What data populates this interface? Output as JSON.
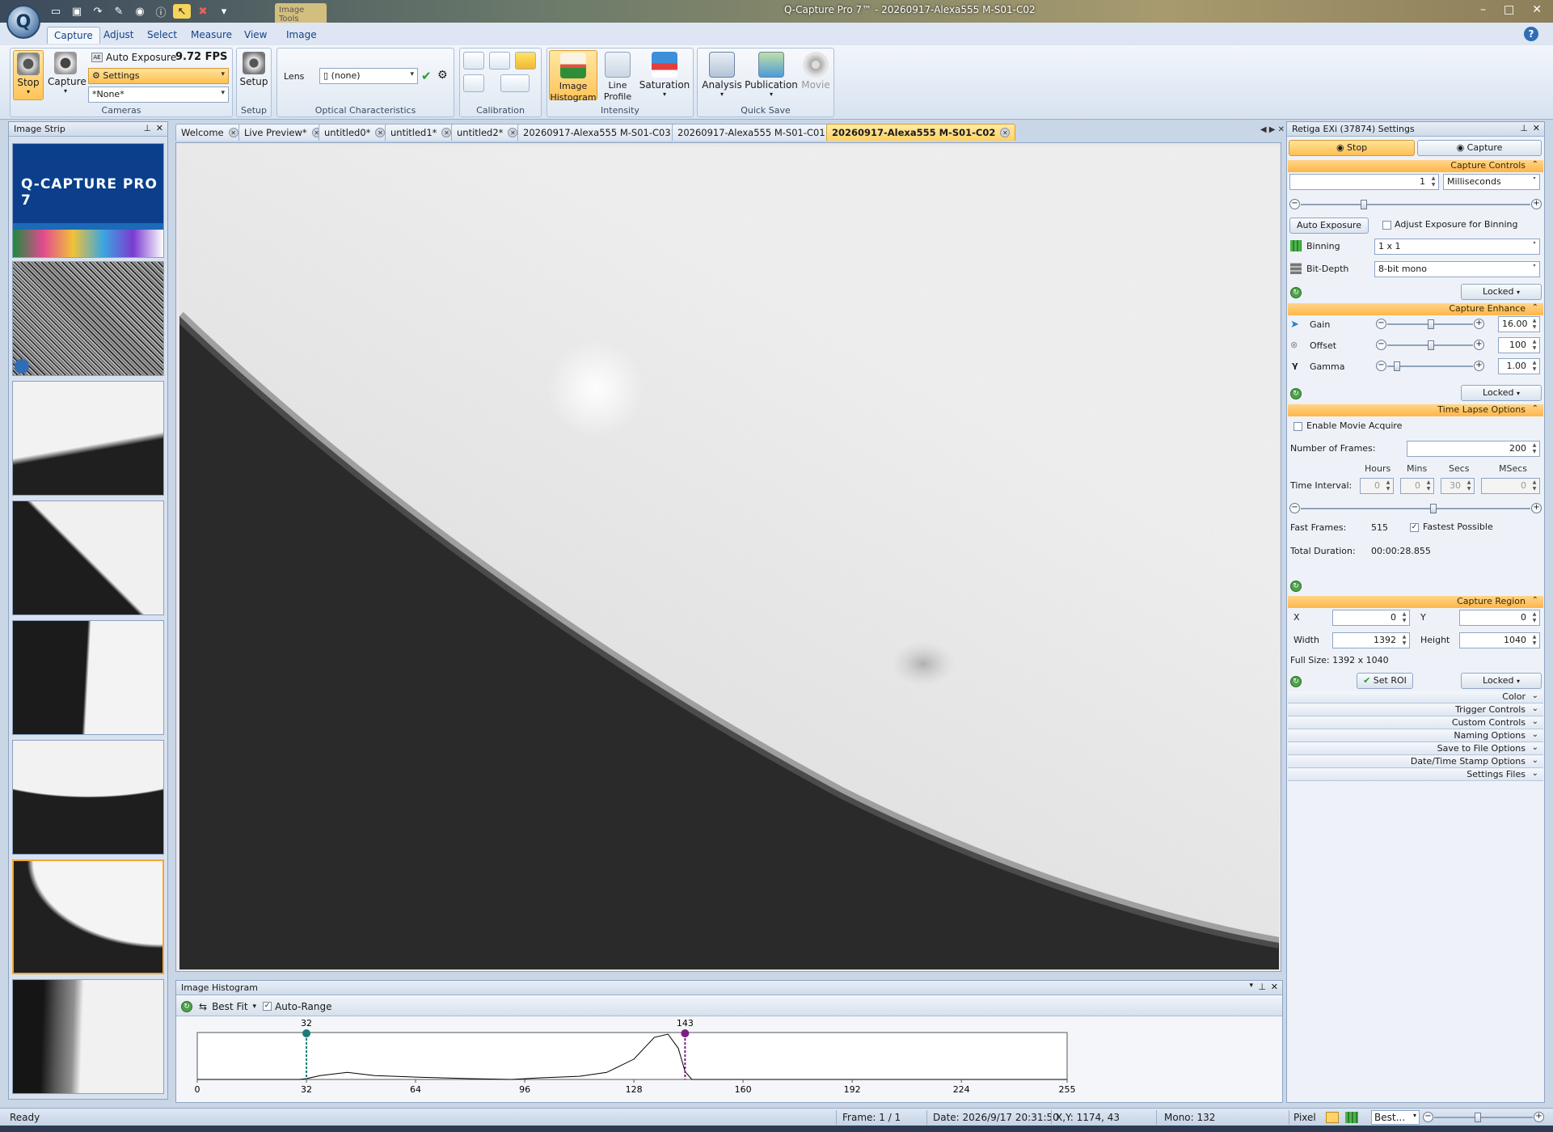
{
  "window": {
    "title": "Q-Capture Pro 7™ - 20260917-Alexa555 M-S01-C02",
    "context_tab": "Image Tools",
    "controls": [
      "–",
      "□",
      "✕"
    ]
  },
  "ribbon": {
    "tabs": [
      "Capture",
      "Adjust",
      "Select",
      "Measure",
      "View",
      "Image"
    ],
    "active_tab": "Capture",
    "cameras": {
      "stop_label": "Stop",
      "capture_label": "Capture",
      "auto_exposure_label": "Auto Exposure",
      "fps": "9.72 FPS",
      "settings_combo": "Settings",
      "preset_combo": "*None*",
      "group_label": "Cameras"
    },
    "setup": {
      "button_label": "Setup",
      "group_label": "Setup"
    },
    "optical": {
      "lens_label": "Lens",
      "lens_value": "(none)",
      "group_label": "Optical Characteristics"
    },
    "calibration": {
      "group_label": "Calibration"
    },
    "intensity": {
      "histogram_label": "Image Histogram",
      "line_profile_label": "Line Profile",
      "saturation_label": "Saturation",
      "group_label": "Intensity"
    },
    "quicksave": {
      "analysis_label": "Analysis",
      "publication_label": "Publication",
      "movie_label": "Movie",
      "group_label": "Quick Save"
    }
  },
  "image_strip": {
    "title": "Image Strip",
    "splash_logo": "Q-CAPTURE PRO 7"
  },
  "doc_tabs": [
    "Welcome",
    "Live Preview*",
    "untitled0*",
    "untitled1*",
    "untitled2*",
    "20260917-Alexa555 M-S01-C03",
    "20260917-Alexa555 M-S01-C01",
    "20260917-Alexa555 M-S01-C02"
  ],
  "active_doc_tab": "20260917-Alexa555 M-S01-C02",
  "histogram": {
    "title": "Image Histogram",
    "fit_label": "Best Fit",
    "auto_range_label": "Auto-Range",
    "auto_range_checked": true,
    "low_marker": "32",
    "high_marker": "143",
    "x_ticks": [
      "0",
      "32",
      "64",
      "96",
      "128",
      "160",
      "192",
      "224",
      "255"
    ],
    "colors": {
      "low": "#1e7b78",
      "high": "#7a1f82"
    }
  },
  "settings": {
    "title": "Retiga EXi (37874) Settings",
    "stop_tab": "Stop",
    "capture_tab": "Capture",
    "capture_controls": {
      "header": "Capture Controls",
      "exposure_value": "1",
      "exposure_unit": "Milliseconds",
      "auto_exposure_btn": "Auto Exposure",
      "adjust_binning_label": "Adjust Exposure for Binning",
      "binning_label": "Binning",
      "binning_value": "1 x 1",
      "bitdepth_label": "Bit-Depth",
      "bitdepth_value": "8-bit mono",
      "locked": "Locked"
    },
    "capture_enhance": {
      "header": "Capture Enhance",
      "gain_label": "Gain",
      "gain_value": "16.00",
      "offset_label": "Offset",
      "offset_value": "100",
      "gamma_label": "Gamma",
      "gamma_value": "1.00",
      "locked": "Locked"
    },
    "time_lapse": {
      "header": "Time Lapse Options",
      "enable_movie_label": "Enable Movie Acquire",
      "frames_label": "Number of Frames:",
      "frames_value": "200",
      "col_hours": "Hours",
      "col_mins": "Mins",
      "col_secs": "Secs",
      "col_msecs": "MSecs",
      "interval_label": "Time Interval:",
      "hours": "0",
      "mins": "0",
      "secs": "30",
      "msecs": "0",
      "fast_frames_label": "Fast Frames:",
      "fast_frames_value": "515",
      "fastest_label": "Fastest Possible",
      "total_label": "Total Duration:",
      "total_value": "00:00:28.855"
    },
    "capture_region": {
      "header": "Capture Region",
      "x_label": "X",
      "x_value": "0",
      "y_label": "Y",
      "y_value": "0",
      "width_label": "Width",
      "width_value": "1392",
      "height_label": "Height",
      "height_value": "1040",
      "full_size": "Full Size: 1392 x 1040",
      "set_roi_btn": "Set ROI",
      "locked": "Locked"
    },
    "collapsed_sections": [
      "Color",
      "Trigger Controls",
      "Custom Controls",
      "Naming Options",
      "Save to File Options",
      "Date/Time Stamp Options",
      "Settings Files"
    ]
  },
  "status": {
    "ready": "Ready",
    "frame": "Frame: 1 / 1",
    "date": "Date: 2026/9/17 20:31:50",
    "xy": "X,Y: 1174,   43",
    "mono": "Mono:   132",
    "unit": "Pixel",
    "zoom": "Best..."
  }
}
